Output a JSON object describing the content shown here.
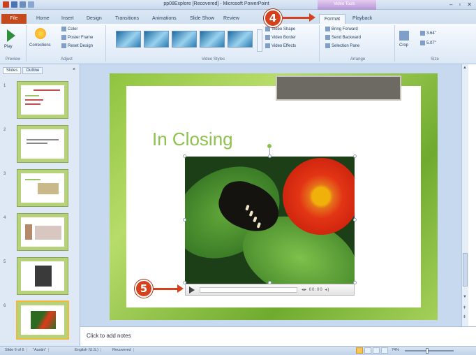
{
  "window": {
    "title": "pp08Explore [Recovered] - Microsoft PowerPoint",
    "contextual_group": "Video Tools"
  },
  "ribbon_tabs": {
    "file": "File",
    "items": [
      "Home",
      "Insert",
      "Design",
      "Transitions",
      "Animations",
      "Slide Show",
      "Review"
    ],
    "format": "Format",
    "playback": "Playback"
  },
  "ribbon": {
    "play_label": "Play",
    "preview_group": "Preview",
    "corrections_label": "Corrections",
    "color_label": "Color",
    "poster_frame_label": "Poster Frame",
    "reset_design_label": "Reset Design",
    "adjust_group": "Adjust",
    "video_styles_group": "Video Styles",
    "video_shape_label": "Video Shape",
    "video_border_label": "Video Border",
    "video_effects_label": "Video Effects",
    "bring_forward_label": "Bring Forward",
    "send_backward_label": "Send Backward",
    "selection_pane_label": "Selection Pane",
    "arrange_group": "Arrange",
    "crop_label": "Crop",
    "height_value": "3.64\"",
    "width_value": "5.07\"",
    "size_group": "Size"
  },
  "callouts": {
    "step4": "4",
    "step5": "5"
  },
  "left_pane": {
    "slides_tab": "Slides",
    "outline_tab": "Outline",
    "close": "×",
    "slide_numbers": [
      "1",
      "2",
      "3",
      "4",
      "5",
      "6"
    ]
  },
  "slide": {
    "title": "In Closing"
  },
  "player": {
    "controls": "◂▸ 00:00 ◂)"
  },
  "notes": {
    "placeholder": "Click to add notes"
  },
  "status": {
    "slide_info": "Slide 6 of 6",
    "theme": "\"Austin\"",
    "language": "English (U.S.)",
    "recovered": "Recovered",
    "zoom": "74%"
  },
  "colors": {
    "file_tab": "#c44a1e",
    "callout": "#d4411c",
    "slide_title": "#8ec24e",
    "slide_border": "#8fc43f"
  }
}
